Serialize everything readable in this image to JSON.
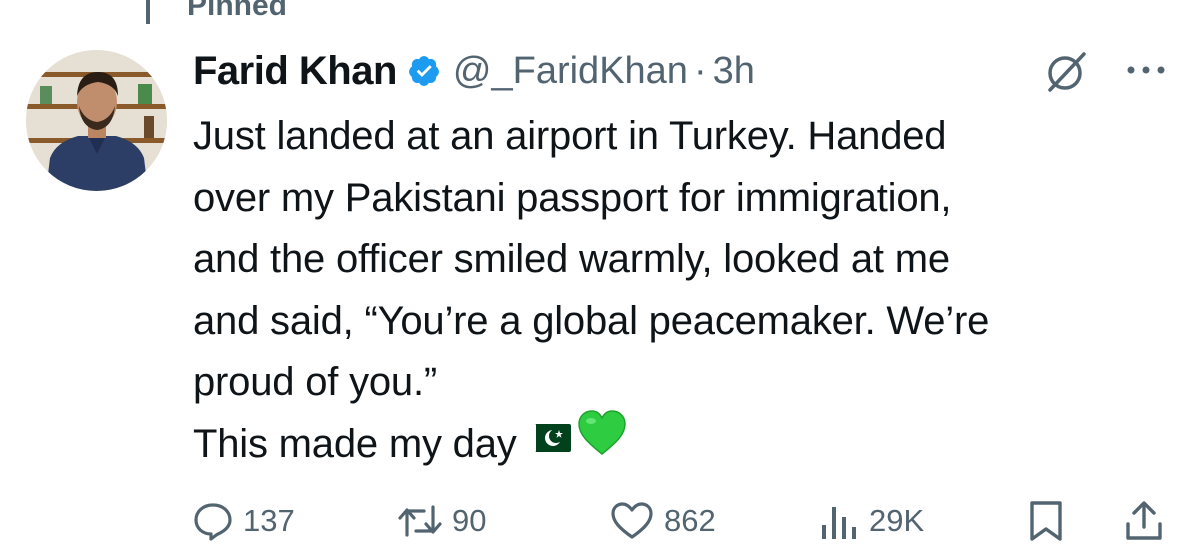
{
  "pinned": {
    "label": "Pinned",
    "icon": "pin-icon"
  },
  "author": {
    "name": "Farid Khan",
    "handle": "@_FaridKhan",
    "separator": "·",
    "time": "3h",
    "verified": true,
    "avatar_icon": "avatar"
  },
  "tweet": {
    "lines": [
      "Just landed at an airport in Turkey. Handed",
      "over my Pakistani passport for immigration,",
      "and the officer smiled warmly, looked at me",
      "and said, “You’re a global peacemaker. We’re",
      "proud of you.”",
      "This made my day"
    ],
    "emojis": [
      "pakistan-flag-icon",
      "green-heart-icon"
    ]
  },
  "actions": {
    "reply": {
      "icon": "reply-icon",
      "count": "137"
    },
    "repost": {
      "icon": "repost-icon",
      "count": "90"
    },
    "like": {
      "icon": "heart-icon",
      "count": "862"
    },
    "views": {
      "icon": "views-icon",
      "count": "29K"
    },
    "bookmark": {
      "icon": "bookmark-icon"
    },
    "share": {
      "icon": "share-icon"
    }
  },
  "colors": {
    "text": "#0f1419",
    "muted": "#536471",
    "verified_blue": "#1d9bf0",
    "flag_green": "#01411c",
    "heart_green": "#2ecc40"
  }
}
